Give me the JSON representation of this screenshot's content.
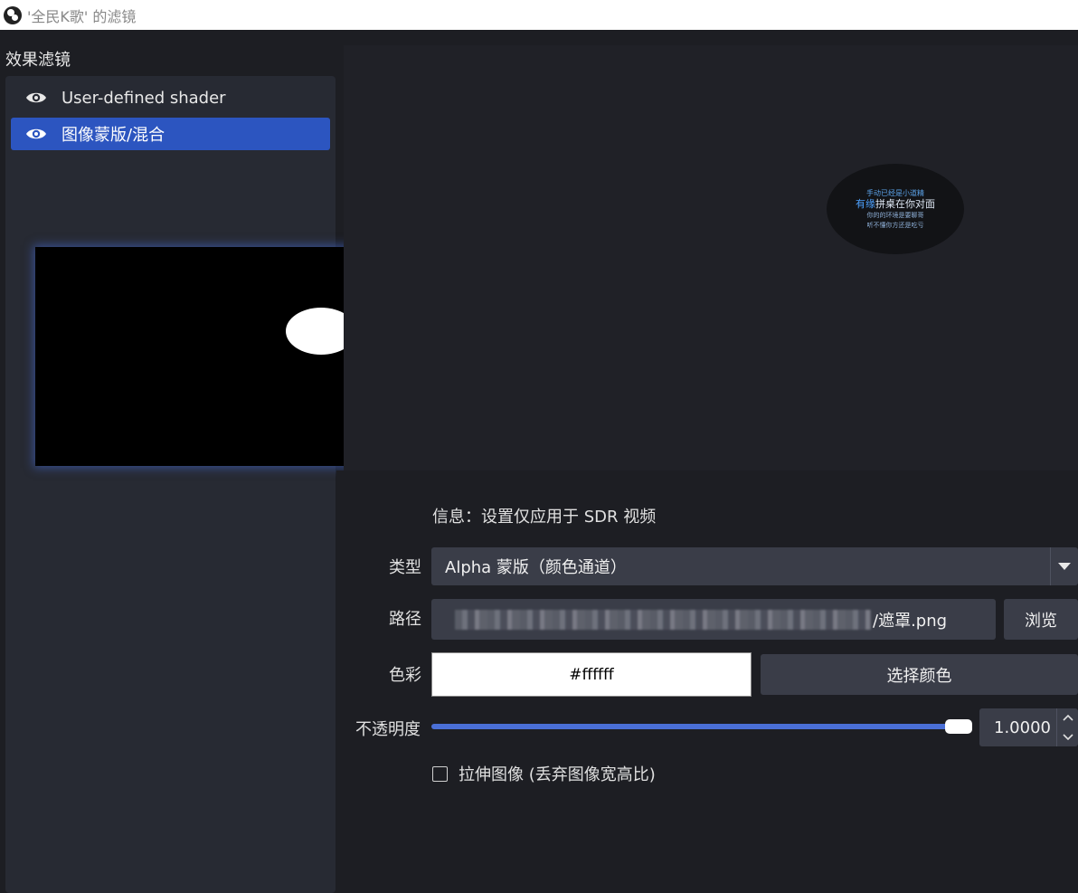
{
  "window": {
    "title": "'全民K歌' 的滤镜"
  },
  "filters": {
    "section_label": "效果滤镜",
    "items": [
      {
        "label": "User-defined shader",
        "visible": true,
        "selected": false
      },
      {
        "label": "图像蒙版/混合",
        "visible": true,
        "selected": true
      }
    ]
  },
  "preview": {
    "lines": [
      "手动已经是小道精",
      "有缘拼桌在你对面",
      "你的的环境是要聊哥",
      "听不懂你方还是吃亏"
    ],
    "highlight_word": "有缘"
  },
  "properties": {
    "info": "信息：设置仅应用于 SDR 视频",
    "type": {
      "label": "类型",
      "value": "Alpha 蒙版（颜色通道）"
    },
    "path": {
      "label": "路径",
      "value_suffix": "/遮罩.png",
      "browse_label": "浏览"
    },
    "color": {
      "label": "色彩",
      "value": "#ffffff",
      "pick_label": "选择颜色"
    },
    "opacity": {
      "label": "不透明度",
      "value": "1.0000",
      "fraction": 1.0
    },
    "stretch": {
      "label": "拉伸图像 (丢弃图像宽高比)",
      "checked": false
    }
  },
  "colors": {
    "accent": "#2c55c0",
    "slider": "#4a6fd6",
    "panel": "#272a33",
    "background": "#1d1e23"
  },
  "icons": [
    "obs-logo-icon",
    "eye-icon",
    "chevron-down-icon",
    "spin-up-icon",
    "spin-down-icon"
  ]
}
